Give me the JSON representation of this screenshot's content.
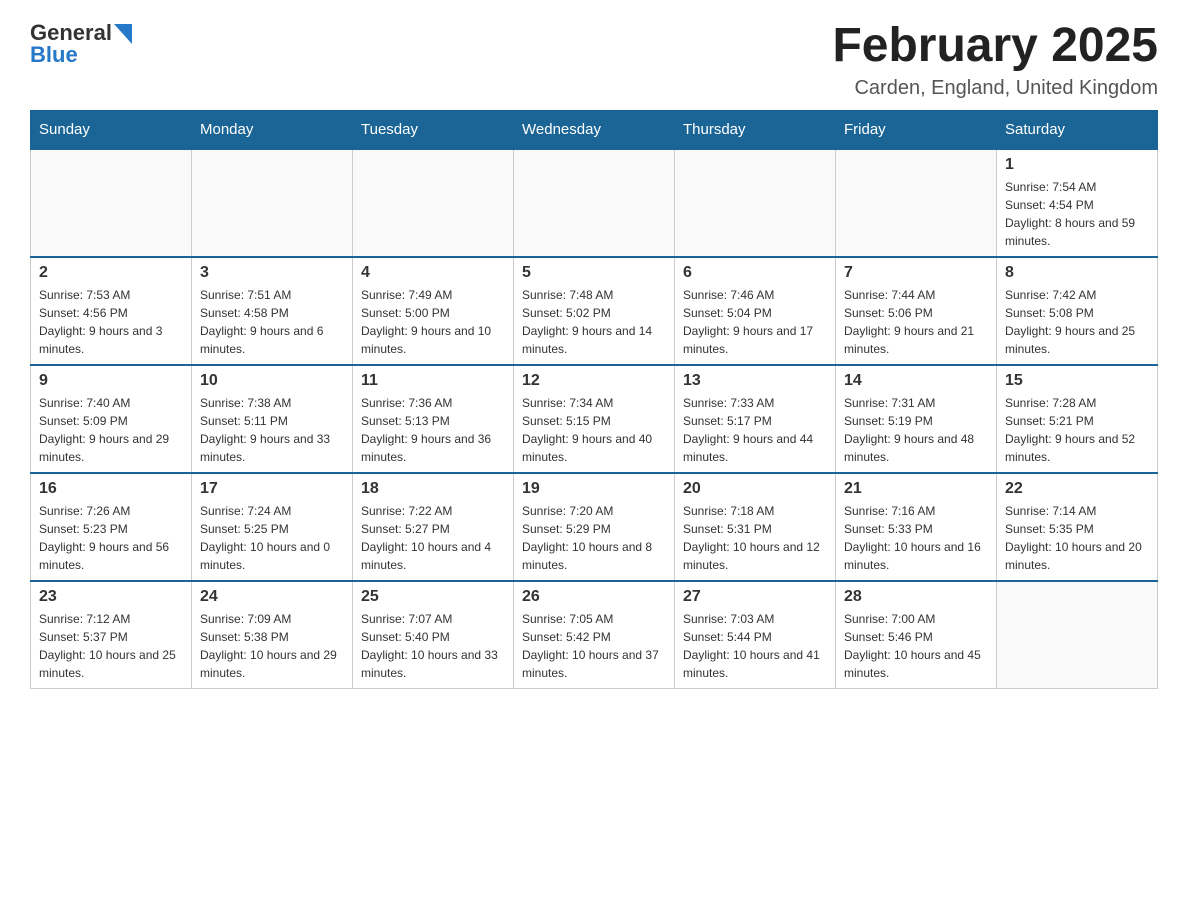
{
  "logo": {
    "text_general": "General",
    "text_blue": "Blue"
  },
  "header": {
    "title": "February 2025",
    "location": "Carden, England, United Kingdom"
  },
  "weekdays": [
    "Sunday",
    "Monday",
    "Tuesday",
    "Wednesday",
    "Thursday",
    "Friday",
    "Saturday"
  ],
  "weeks": [
    [
      {
        "day": "",
        "info": ""
      },
      {
        "day": "",
        "info": ""
      },
      {
        "day": "",
        "info": ""
      },
      {
        "day": "",
        "info": ""
      },
      {
        "day": "",
        "info": ""
      },
      {
        "day": "",
        "info": ""
      },
      {
        "day": "1",
        "info": "Sunrise: 7:54 AM\nSunset: 4:54 PM\nDaylight: 8 hours and 59 minutes."
      }
    ],
    [
      {
        "day": "2",
        "info": "Sunrise: 7:53 AM\nSunset: 4:56 PM\nDaylight: 9 hours and 3 minutes."
      },
      {
        "day": "3",
        "info": "Sunrise: 7:51 AM\nSunset: 4:58 PM\nDaylight: 9 hours and 6 minutes."
      },
      {
        "day": "4",
        "info": "Sunrise: 7:49 AM\nSunset: 5:00 PM\nDaylight: 9 hours and 10 minutes."
      },
      {
        "day": "5",
        "info": "Sunrise: 7:48 AM\nSunset: 5:02 PM\nDaylight: 9 hours and 14 minutes."
      },
      {
        "day": "6",
        "info": "Sunrise: 7:46 AM\nSunset: 5:04 PM\nDaylight: 9 hours and 17 minutes."
      },
      {
        "day": "7",
        "info": "Sunrise: 7:44 AM\nSunset: 5:06 PM\nDaylight: 9 hours and 21 minutes."
      },
      {
        "day": "8",
        "info": "Sunrise: 7:42 AM\nSunset: 5:08 PM\nDaylight: 9 hours and 25 minutes."
      }
    ],
    [
      {
        "day": "9",
        "info": "Sunrise: 7:40 AM\nSunset: 5:09 PM\nDaylight: 9 hours and 29 minutes."
      },
      {
        "day": "10",
        "info": "Sunrise: 7:38 AM\nSunset: 5:11 PM\nDaylight: 9 hours and 33 minutes."
      },
      {
        "day": "11",
        "info": "Sunrise: 7:36 AM\nSunset: 5:13 PM\nDaylight: 9 hours and 36 minutes."
      },
      {
        "day": "12",
        "info": "Sunrise: 7:34 AM\nSunset: 5:15 PM\nDaylight: 9 hours and 40 minutes."
      },
      {
        "day": "13",
        "info": "Sunrise: 7:33 AM\nSunset: 5:17 PM\nDaylight: 9 hours and 44 minutes."
      },
      {
        "day": "14",
        "info": "Sunrise: 7:31 AM\nSunset: 5:19 PM\nDaylight: 9 hours and 48 minutes."
      },
      {
        "day": "15",
        "info": "Sunrise: 7:28 AM\nSunset: 5:21 PM\nDaylight: 9 hours and 52 minutes."
      }
    ],
    [
      {
        "day": "16",
        "info": "Sunrise: 7:26 AM\nSunset: 5:23 PM\nDaylight: 9 hours and 56 minutes."
      },
      {
        "day": "17",
        "info": "Sunrise: 7:24 AM\nSunset: 5:25 PM\nDaylight: 10 hours and 0 minutes."
      },
      {
        "day": "18",
        "info": "Sunrise: 7:22 AM\nSunset: 5:27 PM\nDaylight: 10 hours and 4 minutes."
      },
      {
        "day": "19",
        "info": "Sunrise: 7:20 AM\nSunset: 5:29 PM\nDaylight: 10 hours and 8 minutes."
      },
      {
        "day": "20",
        "info": "Sunrise: 7:18 AM\nSunset: 5:31 PM\nDaylight: 10 hours and 12 minutes."
      },
      {
        "day": "21",
        "info": "Sunrise: 7:16 AM\nSunset: 5:33 PM\nDaylight: 10 hours and 16 minutes."
      },
      {
        "day": "22",
        "info": "Sunrise: 7:14 AM\nSunset: 5:35 PM\nDaylight: 10 hours and 20 minutes."
      }
    ],
    [
      {
        "day": "23",
        "info": "Sunrise: 7:12 AM\nSunset: 5:37 PM\nDaylight: 10 hours and 25 minutes."
      },
      {
        "day": "24",
        "info": "Sunrise: 7:09 AM\nSunset: 5:38 PM\nDaylight: 10 hours and 29 minutes."
      },
      {
        "day": "25",
        "info": "Sunrise: 7:07 AM\nSunset: 5:40 PM\nDaylight: 10 hours and 33 minutes."
      },
      {
        "day": "26",
        "info": "Sunrise: 7:05 AM\nSunset: 5:42 PM\nDaylight: 10 hours and 37 minutes."
      },
      {
        "day": "27",
        "info": "Sunrise: 7:03 AM\nSunset: 5:44 PM\nDaylight: 10 hours and 41 minutes."
      },
      {
        "day": "28",
        "info": "Sunrise: 7:00 AM\nSunset: 5:46 PM\nDaylight: 10 hours and 45 minutes."
      },
      {
        "day": "",
        "info": ""
      }
    ]
  ]
}
